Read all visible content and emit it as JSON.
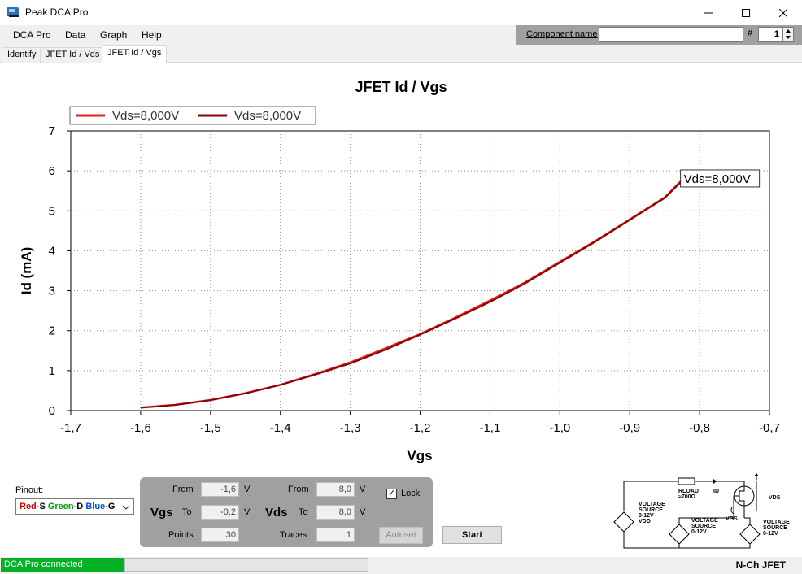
{
  "window": {
    "title": "Peak DCA Pro"
  },
  "menu": [
    "DCA Pro",
    "Data",
    "Graph",
    "Help"
  ],
  "component": {
    "label": "Component name",
    "value": "",
    "hash_label": "#",
    "number": "1"
  },
  "tabs": [
    "Identify",
    "JFET Id / Vds",
    "JFET Id / Vgs"
  ],
  "chart_data": {
    "type": "line",
    "title": "JFET Id / Vgs",
    "xlabel": "Vgs",
    "ylabel": "Id (mA)",
    "xlim": [
      -1.7,
      -0.7
    ],
    "ylim": [
      0,
      7
    ],
    "xticks": [
      "-1,7",
      "-1,6",
      "-1,5",
      "-1,4",
      "-1,3",
      "-1,2",
      "-1,1",
      "-1,0",
      "-0,9",
      "-0,8",
      "-0,7"
    ],
    "yticks": [
      "0",
      "1",
      "2",
      "3",
      "4",
      "5",
      "6",
      "7"
    ],
    "grid": true,
    "legend_position": "top-left",
    "series": [
      {
        "name": "Vds=8,000V",
        "color": "#e02020",
        "x": [
          -1.6,
          -1.55,
          -1.5,
          -1.45,
          -1.4,
          -1.35,
          -1.3,
          -1.25,
          -1.2,
          -1.15,
          -1.1,
          -1.05,
          -1.0,
          -0.95,
          -0.9,
          -0.85,
          -0.825
        ],
        "y": [
          0.08,
          0.15,
          0.27,
          0.44,
          0.65,
          0.92,
          1.21,
          1.56,
          1.92,
          2.33,
          2.76,
          3.21,
          3.73,
          4.24,
          4.79,
          5.34,
          5.78
        ]
      },
      {
        "name": "Vds=8,000V",
        "color": "#8b0000",
        "x": [
          -1.6,
          -1.55,
          -1.5,
          -1.45,
          -1.4,
          -1.35,
          -1.3,
          -1.25,
          -1.2,
          -1.15,
          -1.1,
          -1.05,
          -1.0,
          -0.95,
          -0.9,
          -0.85,
          -0.825
        ],
        "y": [
          0.07,
          0.14,
          0.26,
          0.43,
          0.64,
          0.9,
          1.18,
          1.52,
          1.9,
          2.3,
          2.72,
          3.18,
          3.7,
          4.22,
          4.77,
          5.32,
          5.75
        ]
      }
    ],
    "annotation": "Vds=8,000V"
  },
  "pinout": {
    "label": "Pinout:",
    "parts": [
      {
        "text": "Red",
        "color": "#d00000"
      },
      {
        "text": "-S ",
        "color": "#000000"
      },
      {
        "text": "Green",
        "color": "#00a000"
      },
      {
        "text": "-D ",
        "color": "#000000"
      },
      {
        "text": "Blue",
        "color": "#0050c8"
      },
      {
        "text": "-G",
        "color": "#000000"
      }
    ]
  },
  "controls": {
    "vgs_label": "Vgs",
    "vds_label": "Vds",
    "from_label": "From",
    "to_label": "To",
    "unit": "V",
    "vgs_from": "-1,6",
    "vgs_to": "-0,2",
    "vds_from": "8,0",
    "vds_to": "8,0",
    "points_label": "Points",
    "points": "30",
    "traces_label": "Traces",
    "traces": "1",
    "lock_label": "Lock",
    "lock_checked": "✓",
    "autoset": "Autoset",
    "start": "Start"
  },
  "schematic": {
    "rload": "RLOAD",
    "rload_val": "≈700Ω",
    "id": "ID",
    "vds": "VDS",
    "vgs": "VGS",
    "src_left": [
      "VOLTAGE",
      "SOURCE",
      "0-12V",
      "VDD"
    ],
    "src_mid": [
      "VOLTAGE",
      "SOURCE",
      "0-12V"
    ],
    "src_right": [
      "VOLTAGE",
      "SOURCE",
      "0-12V"
    ]
  },
  "status": {
    "connection": "DCA Pro connected",
    "device": "N-Ch JFET"
  }
}
